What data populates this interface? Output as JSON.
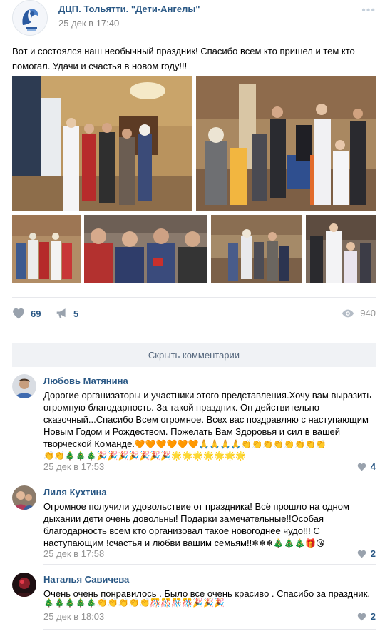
{
  "post": {
    "author": "ДЦП. Тольятти. \"Дети-Ангелы\"",
    "date": "25 дек в 17:40",
    "text": "Вот и состоялся наш необычный праздник! Спасибо всем кто пришел и тем кто помогал. Удачи и счастья в новом году!!!",
    "likes": "69",
    "reposts": "5",
    "views": "940"
  },
  "hide_comments_label": "Скрыть комментарии",
  "comments": [
    {
      "name": "Любовь Матянина",
      "text": "Дорогие организаторы и участники этого представления.Хочу вам выразить огромную благодарность. За такой праздник. Он действительно сказочный...Спасибо Всем огромное. Всех вас поздравляю с наступающим Новым Годом и Рождеством. Пожелать Вам Здоровья и сил в вашей творческой Команде.",
      "emoji_tail": "🧡🧡🧡🧡🧡🧡🙏🙏🙏🙏👏👏👏👏👏👏👏👏",
      "emoji_line": "👏👏🎄🎄🎄🎉🎉🎉🎉🎉🎉🎉🌟🌟🌟🌟🌟🌟🌟",
      "date": "25 дек в 17:53",
      "likes": "4"
    },
    {
      "name": "Лиля Кухтина",
      "text": "Огромное получили удовольствие от праздника! Всё прошло на одном дыхании дети очень довольны! Подарки замечательные!!Особая благодарность всем кто организовал такое новогоднее чудо!!! С наступающим !счастья и любви вашим семьям!!",
      "emoji_tail": "❄❄❄🎄🎄🎄🎁😘",
      "date": "25 дек в 17:58",
      "likes": "2"
    },
    {
      "name": "Наталья Савичева",
      "text": "Очень очень понравилось . Было все очень красиво . Спасибо за праздник.",
      "emoji_line": "🎄🎄🎄🎄🎄👏👏👏👏👏🎊🎊🎊🎊🎉🎉🎉",
      "date": "25 дек в 18:03",
      "likes": "2"
    }
  ],
  "icons": {
    "heart": "heart-icon",
    "repost": "megaphone-icon",
    "views": "eye-icon",
    "more": "more-icon"
  },
  "colors": {
    "link": "#2a5885",
    "muted": "#939393",
    "icon": "#99a2ad",
    "divider": "#e7e8ec"
  }
}
